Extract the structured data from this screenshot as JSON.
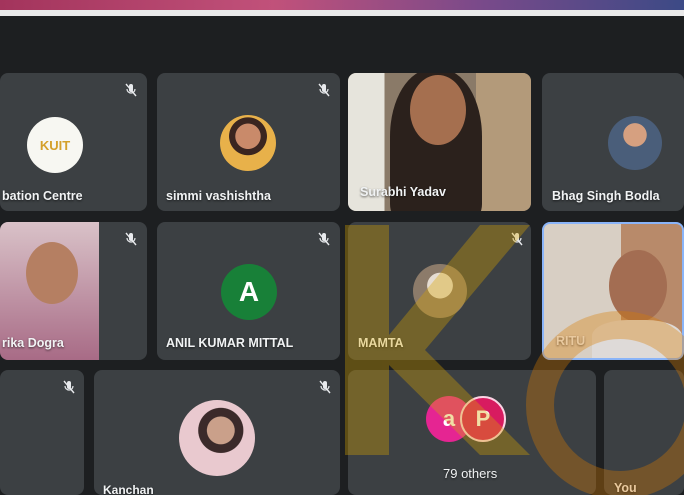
{
  "participants": [
    {
      "name": "bation Centre",
      "avatar_text": "KUIT"
    },
    {
      "name": "simmi vashishtha"
    },
    {
      "name": "Surabhi Yadav"
    },
    {
      "name": "Bhag Singh Bodla"
    },
    {
      "name": "rika Dogra"
    },
    {
      "name": "ANIL KUMAR MITTAL",
      "initial": "A"
    },
    {
      "name": "MAMTA"
    },
    {
      "name": "RITU"
    },
    {
      "name": "Kanchan"
    },
    {
      "name": "You"
    }
  ],
  "others": {
    "label": "79 others",
    "avatar_letters": [
      "a",
      "P"
    ]
  },
  "icons": {
    "mute": "mic-off-icon"
  },
  "colors": {
    "tile": "#3c4043",
    "background": "#1d1f21",
    "anil_avatar": "#188038",
    "others_a": "#e52592",
    "others_p": "#d81b60",
    "active_border": "#8ab4f8"
  }
}
